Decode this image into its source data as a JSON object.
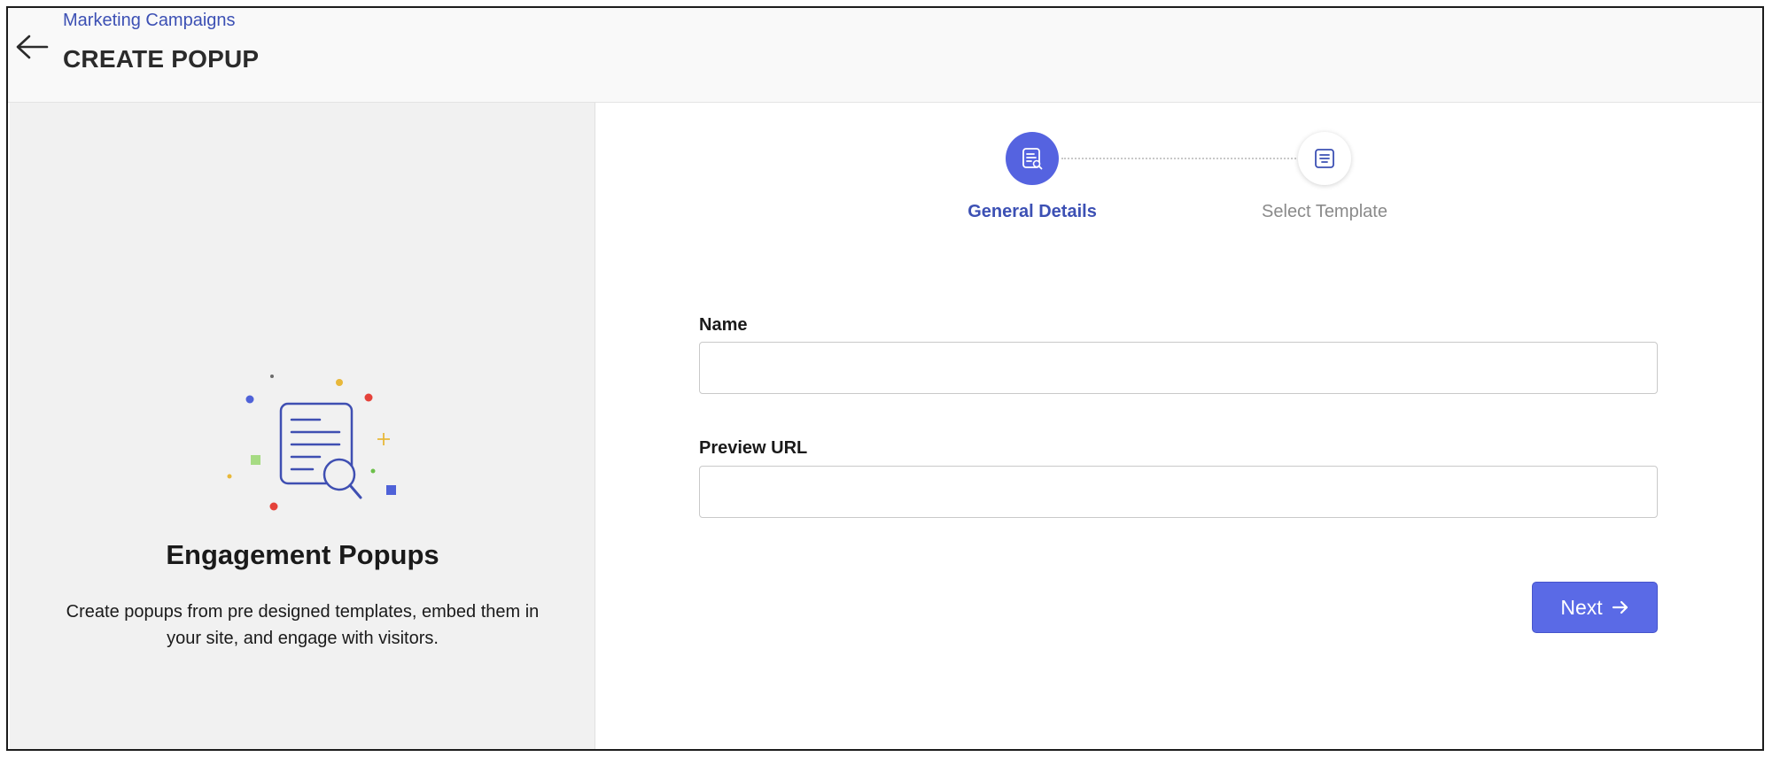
{
  "header": {
    "back_icon": "arrow-left-icon",
    "breadcrumb": "Marketing Campaigns",
    "title": "CREATE POPUP"
  },
  "left_panel": {
    "illustration_icon": "document-search-icon",
    "title": "Engagement Popups",
    "description": "Create popups from pre designed templates, embed them in your site, and engage with visitors."
  },
  "stepper": {
    "steps": [
      {
        "label": "General Details",
        "state": "active",
        "icon": "document-search-icon"
      },
      {
        "label": "Select Template",
        "state": "inactive",
        "icon": "template-icon"
      }
    ]
  },
  "form": {
    "name_label": "Name",
    "name_value": "",
    "preview_url_label": "Preview URL",
    "preview_url_value": ""
  },
  "actions": {
    "next_label": "Next",
    "next_icon": "arrow-right-icon"
  },
  "colors": {
    "accent": "#5a6ae6",
    "link": "#3c50b4",
    "panel_bg": "#f1f1f1",
    "header_bg": "#f9f9f9"
  }
}
